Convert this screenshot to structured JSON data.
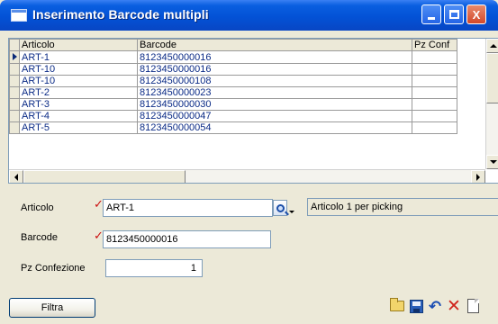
{
  "window": {
    "title": "Inserimento Barcode multipli",
    "minimize": "_",
    "maximize": "□",
    "close": "X"
  },
  "grid": {
    "columns": [
      "Articolo",
      "Barcode",
      "Pz Conf"
    ],
    "rows": [
      {
        "articolo": "ART-1",
        "barcode": "8123450000016",
        "pz": ""
      },
      {
        "articolo": "ART-10",
        "barcode": "8123450000016",
        "pz": ""
      },
      {
        "articolo": "ART-10",
        "barcode": "8123450000108",
        "pz": ""
      },
      {
        "articolo": "ART-2",
        "barcode": "8123450000023",
        "pz": ""
      },
      {
        "articolo": "ART-3",
        "barcode": "8123450000030",
        "pz": ""
      },
      {
        "articolo": "ART-4",
        "barcode": "8123450000047",
        "pz": ""
      },
      {
        "articolo": "ART-5",
        "barcode": "8123450000054",
        "pz": ""
      }
    ],
    "selected_row": 0
  },
  "form": {
    "articolo": {
      "label": "Articolo",
      "value": "ART-1",
      "description": "Articolo 1 per picking"
    },
    "barcode": {
      "label": "Barcode",
      "value": "8123450000016"
    },
    "pz_confezione": {
      "label": "Pz Confezione",
      "value": "1"
    },
    "required_mark": "✓"
  },
  "buttons": {
    "filtra": "Filtra"
  },
  "toolbar_icons": [
    "folder-open-icon",
    "save-icon",
    "undo-icon",
    "delete-icon",
    "new-document-icon"
  ],
  "colors": {
    "titlebar": "#0352d6",
    "grid_text": "#0b2b86",
    "required": "#cc1010",
    "background": "#ece9d8"
  }
}
